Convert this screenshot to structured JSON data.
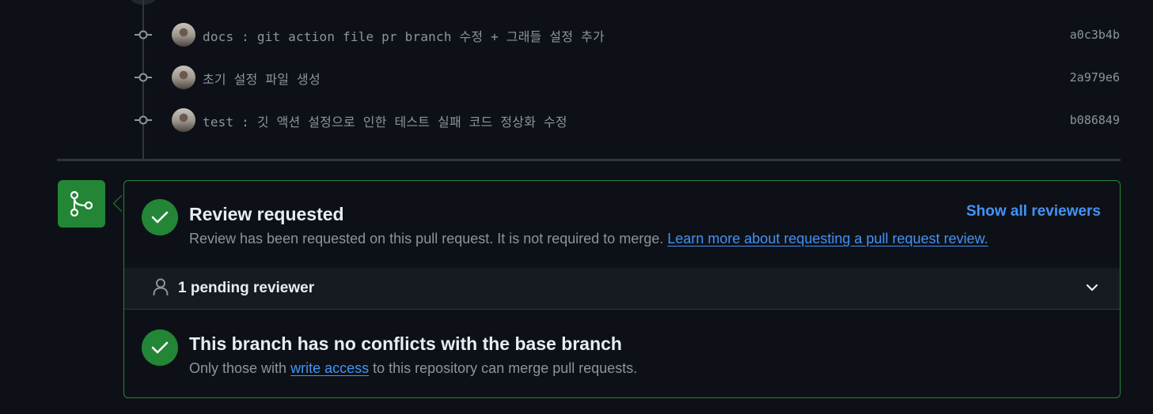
{
  "commits": [
    {
      "message": "docs : git action file pr branch 수정 + 그래들 설정 추가",
      "sha": "a0c3b4b"
    },
    {
      "message": "초기 설정 파일 생성",
      "sha": "2a979e6"
    },
    {
      "message": "test : 깃 액션 설정으로 인한 테스트 실패 코드 정상화 수정",
      "sha": "b086849"
    }
  ],
  "review": {
    "title": "Review requested",
    "description": "Review has been requested on this pull request. It is not required to merge.",
    "learn_more_link": "Learn more about requesting a pull request review.",
    "show_all_label": "Show all reviewers",
    "pending_label": "1 pending reviewer"
  },
  "conflicts": {
    "title": "This branch has no conflicts with the base branch",
    "desc_before": "Only those with",
    "write_access_link": "write access",
    "desc_after": "to this repository can merge pull requests."
  },
  "colors": {
    "background": "#0d1117",
    "success": "#238636",
    "link": "#4493f8",
    "muted": "#8b949e"
  },
  "icons": [
    "git-merge-icon",
    "check-icon",
    "person-icon",
    "chevron-down-icon",
    "git-commit-icon"
  ]
}
